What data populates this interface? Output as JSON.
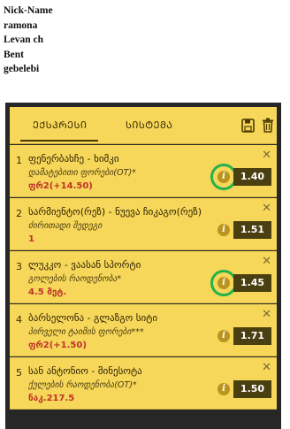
{
  "name_list": [
    "Nick-Name",
    "ramona",
    "Levan ch",
    "Bent",
    "gebelebi"
  ],
  "tabs": {
    "express": "ᲔᲥᲡᲞᲠᲔᲡᲘ",
    "system": "ᲡᲘᲡᲢᲔᲛᲐ"
  },
  "bets": [
    {
      "num": "1",
      "title": "ფენერბახჩე - ხიმკი",
      "market": "დამატებითი ფორები(OT)*",
      "pick": "ფრ2(+14.50)",
      "odds": "1.40"
    },
    {
      "num": "2",
      "title": "სარმიენტო(რეზ) - ნუევა ჩიკაგო(რეზ)",
      "market": "ძირითადი შედეგი",
      "pick": "1",
      "odds": "1.51"
    },
    {
      "num": "3",
      "title": "ლუკკო - ვაასან სპორტი",
      "market": "გოლების რაოდენობა*",
      "pick": "4.5 მეტ.",
      "odds": "1.45"
    },
    {
      "num": "4",
      "title": "ბარსელონა - გლაზგო სიტი",
      "market": "პირველი ტაიმის ფორები***",
      "pick": "ფრ2(+1.50)",
      "odds": "1.71"
    },
    {
      "num": "5",
      "title": "სან ანტონიო - მინესოტა",
      "market": "ქულების რაოდენობა(OT)*",
      "pick": "ნაკ.217.5",
      "odds": "1.50"
    }
  ],
  "colors": {
    "panel_bg": "#272727",
    "card_bg": "#f6d75a",
    "odds_bg": "#4a3f10",
    "pick_text": "#c0312b",
    "highlight_ring": "#23b24b"
  }
}
